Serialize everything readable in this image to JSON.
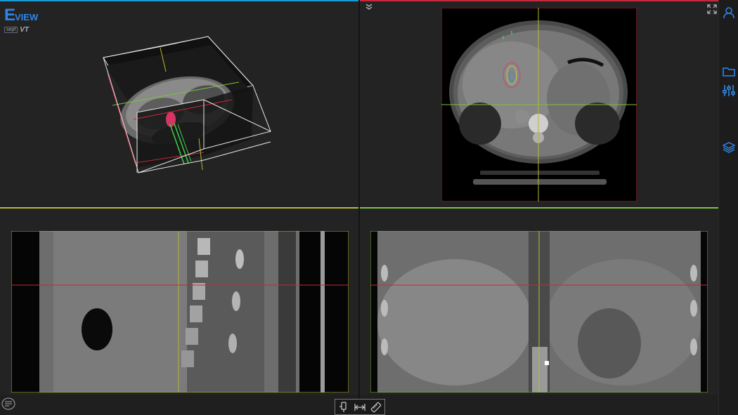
{
  "app": {
    "logo_main": "E",
    "logo_rest": "VIEW",
    "logo_sub1": "sepf",
    "logo_sub2": "VT"
  },
  "colors": {
    "accent": "#2f86e6",
    "axial_line": "#c8283c",
    "sagittal_line": "#b8ba2e",
    "coronal_line": "#7cc23e",
    "top_bar_left": "#1c9ad6",
    "top_bar_right": "#c8283c"
  },
  "views": [
    {
      "name": "3d-view",
      "icon": "collapse-chevron-icon"
    },
    {
      "name": "axial-view",
      "icon": "fullscreen-icon"
    },
    {
      "name": "sagittal-view"
    },
    {
      "name": "coronal-view"
    }
  ],
  "sidebar": {
    "items": [
      {
        "icon": "user-icon"
      },
      {
        "icon": "folder-icon"
      },
      {
        "icon": "sliders-icon"
      },
      {
        "icon": "layers-icon"
      }
    ]
  },
  "toolbar": {
    "items": [
      {
        "icon": "probe-icon"
      },
      {
        "icon": "measure-distance-icon"
      },
      {
        "icon": "ruler-icon"
      }
    ]
  },
  "menu": {
    "icon": "menu-list-icon"
  }
}
